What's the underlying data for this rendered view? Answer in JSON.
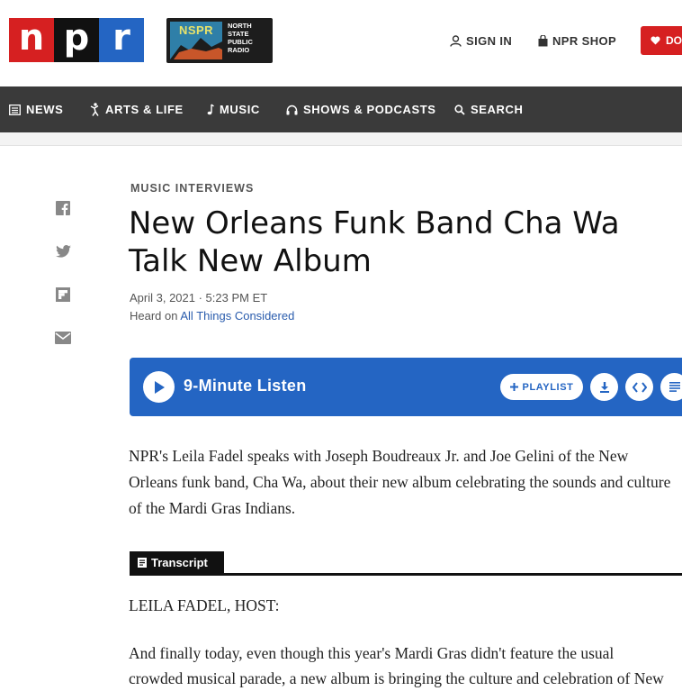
{
  "header": {
    "npr_letters": [
      "n",
      "p",
      "r"
    ],
    "npr_colors": [
      "#d62021",
      "#111111",
      "#2465c3"
    ],
    "station_logo": {
      "abbr": "NSPR",
      "lines": [
        "NORTH",
        "STATE",
        "PUBLIC",
        "RADIO"
      ]
    },
    "sign_in": "SIGN IN",
    "shop": "NPR SHOP",
    "donate": "DO"
  },
  "nav": {
    "items": [
      {
        "label": "NEWS",
        "icon": "newspaper-icon"
      },
      {
        "label": "ARTS & LIFE",
        "icon": "dancer-icon"
      },
      {
        "label": "MUSIC",
        "icon": "music-note-icon"
      },
      {
        "label": "SHOWS & PODCASTS",
        "icon": "headphones-icon"
      },
      {
        "label": "SEARCH",
        "icon": "search-icon"
      }
    ]
  },
  "share": [
    "facebook-icon",
    "twitter-icon",
    "flipboard-icon",
    "email-icon"
  ],
  "article": {
    "slug": "MUSIC INTERVIEWS",
    "headline": "New Orleans Funk Band Cha Wa Talk New Album",
    "date": "April 3, 2021 · 5:23 PM ET",
    "heard_on_prefix": "Heard on ",
    "heard_on_show": "All Things Considered",
    "teaser": "NPR's Leila Fadel speaks with Joseph Boudreaux Jr. and Joe Gelini of the New Orleans funk band, Cha Wa, about their new album celebrating the sounds and culture of the Mardi Gras Indians."
  },
  "player": {
    "listen_label": "9-Minute Listen",
    "playlist_label": "PLAYLIST"
  },
  "transcript": {
    "tab_label": "Transcript",
    "speaker": "LEILA FADEL, HOST:",
    "line1": "And finally today, even though this year's Mardi Gras didn't feature the usual",
    "line2": "crowded musical parade, a new album is bringing the culture and celebration of New"
  },
  "colors": {
    "accent_blue": "#2465c3",
    "npr_red": "#d62021",
    "nav_bg": "#3a3a3a"
  }
}
